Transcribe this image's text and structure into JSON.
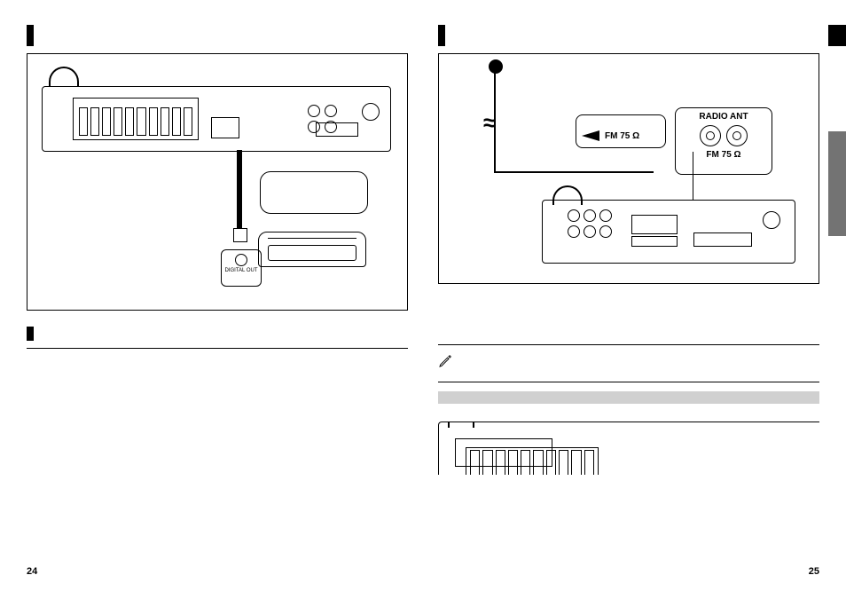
{
  "left": {
    "figure": {
      "digital_out_label": "DIGITAL OUT"
    }
  },
  "right": {
    "figure": {
      "fm_callout": "FM 75 Ω",
      "radio_ant_title": "RADIO ANT",
      "radio_ant_sub": "FM 75 Ω",
      "antenna_wave_glyph": "≈"
    }
  },
  "page_numbers": {
    "left": "24",
    "right": "25"
  },
  "icons": {
    "pencil": "pencil-icon"
  }
}
